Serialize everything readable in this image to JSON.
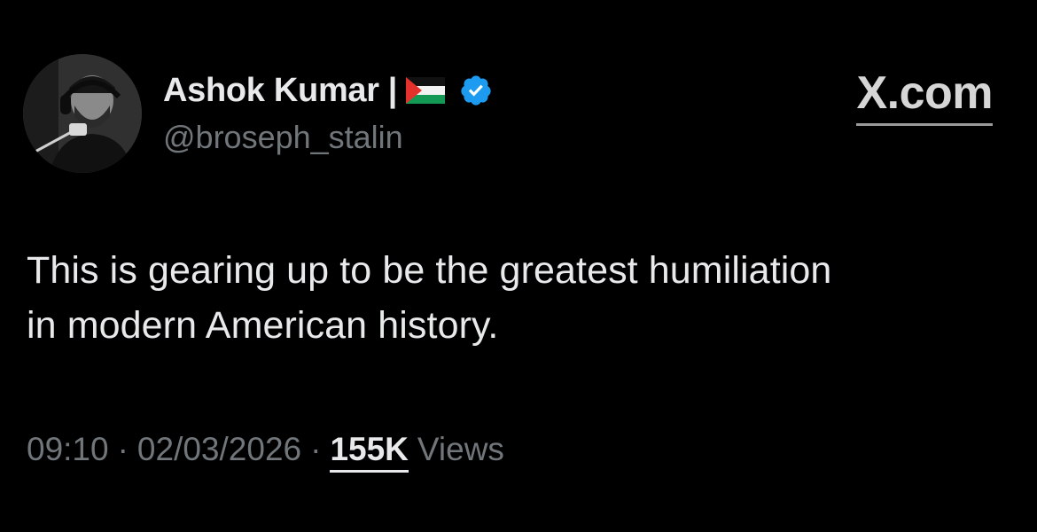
{
  "author": {
    "display_name": "Ashok Kumar",
    "separator": "|",
    "flag_icon": "palestine-flag-icon",
    "verified_icon": "verified-badge-icon",
    "verified_color": "#1d9bf0",
    "handle": "@broseph_stalin"
  },
  "source_link": {
    "label": "X.com"
  },
  "tweet": {
    "text_line1": "This is gearing up to be the greatest humiliation",
    "text_line2": "in modern American history."
  },
  "meta": {
    "time": "09:10",
    "dot": "·",
    "date": "02/03/2026",
    "views_count": "155K",
    "views_label": "Views"
  },
  "colors": {
    "background": "#000000",
    "primary_text": "#e7e9ea",
    "secondary_text": "#71767b"
  }
}
